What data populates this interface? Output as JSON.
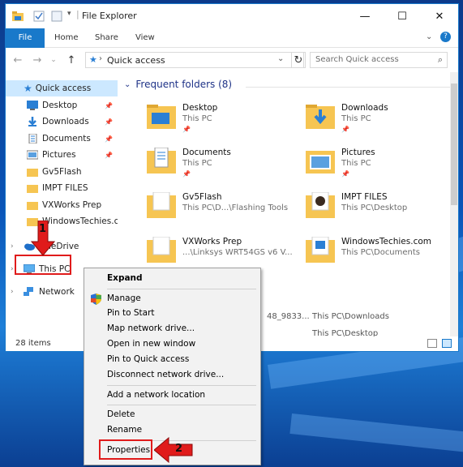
{
  "window": {
    "title": "File Explorer"
  },
  "ribbon": {
    "tabs": [
      "File",
      "Home",
      "Share",
      "View"
    ]
  },
  "address": {
    "path": "Quick access",
    "search_placeholder": "Search Quick access"
  },
  "nav": {
    "quick_access": "Quick access",
    "quick_items": [
      "Desktop",
      "Downloads",
      "Documents",
      "Pictures",
      "Gv5Flash",
      "IMPT FILES",
      "VXWorks Prep",
      "WindowsTechies.co"
    ],
    "onedrive": "OneDrive",
    "this_pc": "This PC",
    "network": "Network"
  },
  "content": {
    "section_title": "Frequent folders (8)",
    "folders": [
      {
        "name": "Desktop",
        "path": "This PC"
      },
      {
        "name": "Downloads",
        "path": "This PC"
      },
      {
        "name": "Documents",
        "path": "This PC"
      },
      {
        "name": "Pictures",
        "path": "This PC"
      },
      {
        "name": "Gv5Flash",
        "path": "This PC\\D...\\Flashing Tools"
      },
      {
        "name": "IMPT FILES",
        "path": "This PC\\Desktop"
      },
      {
        "name": "VXWorks Prep",
        "path": "...\\Linksys WRT54GS v6 V..."
      },
      {
        "name": "WindowsTechies.com",
        "path": "This PC\\Documents"
      }
    ],
    "recent": [
      {
        "name": "48_9833...",
        "path": "This PC\\Downloads"
      },
      {
        "name": "",
        "path": "This PC\\Desktop"
      }
    ]
  },
  "status": {
    "items": "28 items"
  },
  "context_menu": {
    "items": [
      "Expand",
      "Manage",
      "Pin to Start",
      "Map network drive...",
      "Open in new window",
      "Pin to Quick access",
      "Disconnect network drive...",
      "Add a network location",
      "Delete",
      "Rename",
      "Properties"
    ]
  },
  "annotations": {
    "step1": "1",
    "step2": "2"
  },
  "colors": {
    "accent": "#1979ca",
    "highlight": "#e01b1b",
    "selected": "#cce8ff",
    "folder": "#f6c552"
  }
}
